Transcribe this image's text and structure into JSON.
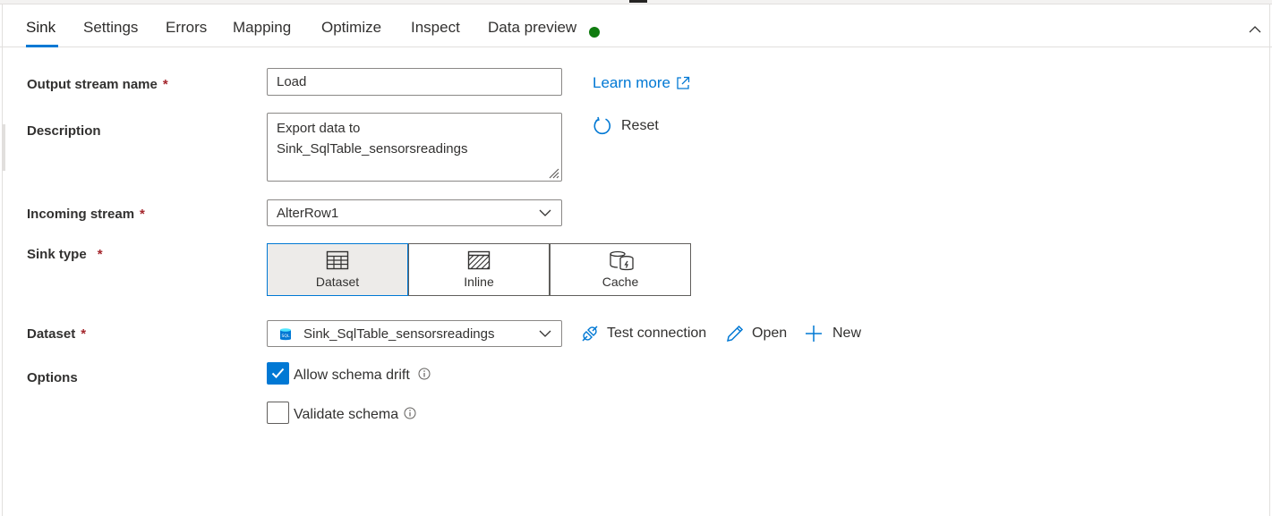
{
  "tabs": [
    {
      "label": "Sink",
      "active": true
    },
    {
      "label": "Settings"
    },
    {
      "label": "Errors"
    },
    {
      "label": "Mapping"
    },
    {
      "label": "Optimize"
    },
    {
      "label": "Inspect"
    },
    {
      "label": "Data preview"
    }
  ],
  "data_preview_status_color": "#107c10",
  "form": {
    "output_stream_label": "Output stream name",
    "output_stream_value": "Load",
    "description_label": "Description",
    "description_value": "Export data to\nSink_SqlTable_sensorsreadings",
    "incoming_stream_label": "Incoming stream",
    "incoming_stream_value": "AlterRow1",
    "sink_type_label": "Sink type",
    "sink_types": [
      {
        "label": "Dataset",
        "icon": "table-icon",
        "selected": true
      },
      {
        "label": "Inline",
        "icon": "inline-icon"
      },
      {
        "label": "Cache",
        "icon": "cache-icon"
      }
    ],
    "dataset_label": "Dataset",
    "dataset_value": "Sink_SqlTable_sensorsreadings",
    "options_label": "Options",
    "required_marker": "*",
    "allow_schema_drift": {
      "label": "Allow schema drift",
      "checked": true
    },
    "validate_schema": {
      "label": "Validate schema",
      "checked": false
    }
  },
  "actions": {
    "learn_more": "Learn more",
    "reset": "Reset",
    "test_connection": "Test connection",
    "open": "Open",
    "new": "New"
  },
  "colors": {
    "accent": "#0078d4",
    "required": "#a4262c",
    "selected_bg": "#edebe9"
  }
}
